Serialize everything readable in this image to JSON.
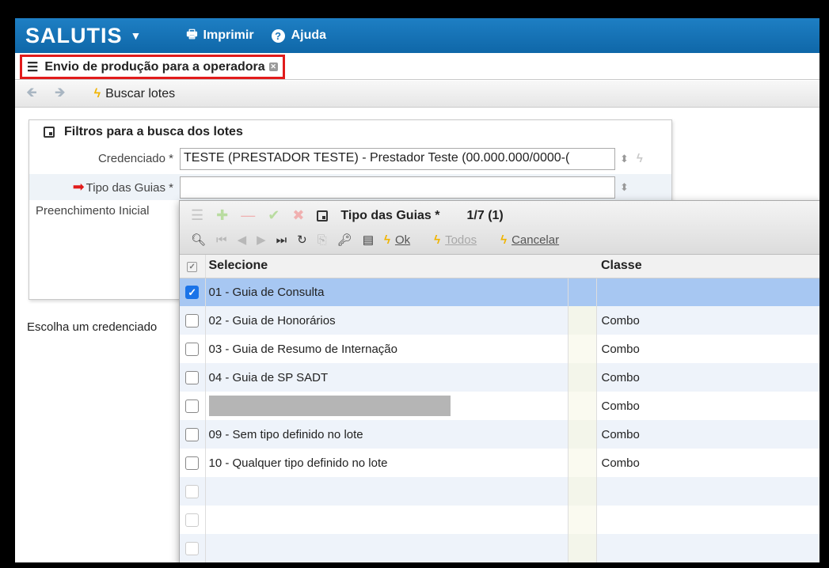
{
  "app": {
    "brand": "SALUTIS",
    "print_label": "Imprimir",
    "help_label": "Ajuda"
  },
  "tab": {
    "title": "Envio de produção para a operadora"
  },
  "toolbar": {
    "search_label": "Buscar lotes"
  },
  "filters": {
    "title": "Filtros para a busca dos lotes",
    "credenciado_label": "Credenciado *",
    "credenciado_value": "TESTE (PRESTADOR TESTE) - Prestador Teste (00.000.000/0000-(",
    "tipo_label": "Tipo das Guias *",
    "tipo_value": "",
    "preenchimento_label": "Preenchimento Inicial"
  },
  "note": "Escolha um credenciado",
  "popup": {
    "title": "Tipo das Guias *",
    "counter": "1/7 (1)",
    "ok_label": "Ok",
    "todos_label": "Todos",
    "cancel_label": "Cancelar",
    "col_select": "Selecione",
    "col_class": "Classe",
    "rows": [
      {
        "label": "01 - Guia de Consulta",
        "classe": "",
        "checked": true
      },
      {
        "label": "02 - Guia de Honorários",
        "classe": "Combo",
        "checked": false
      },
      {
        "label": "03 - Guia de Resumo de Internação",
        "classe": "Combo",
        "checked": false
      },
      {
        "label": "04 - Guia de SP SADT",
        "classe": "Combo",
        "checked": false
      },
      {
        "label": "",
        "classe": "Combo",
        "checked": false
      },
      {
        "label": "09 - Sem tipo definido no lote",
        "classe": "Combo",
        "checked": false
      },
      {
        "label": "10 - Qualquer tipo definido no lote",
        "classe": "Combo",
        "checked": false
      }
    ]
  }
}
